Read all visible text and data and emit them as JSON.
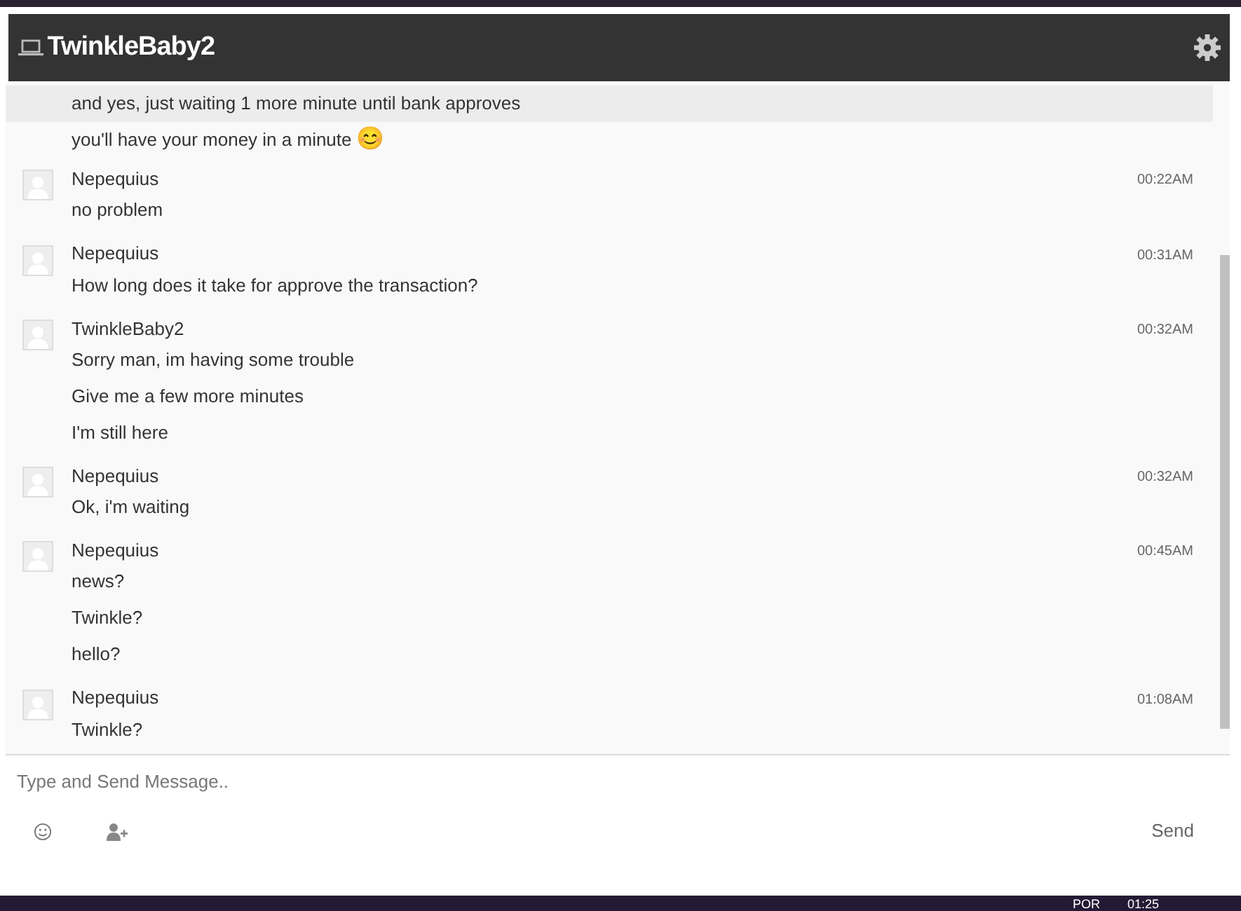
{
  "window": {
    "title": "TwinkleBaby2"
  },
  "messages": [
    {
      "lines": [
        {
          "text": "and yes, just waiting 1 more minute until bank approves",
          "highlighted": true
        },
        {
          "text": "you'll have your money in a minute",
          "highlighted": false,
          "emoji": "😊"
        }
      ]
    },
    {
      "sender": "Nepequius",
      "time": "00:22AM",
      "lines": [
        {
          "text": "no problem",
          "highlighted": false
        }
      ]
    },
    {
      "sender": "Nepequius",
      "time": "00:31AM",
      "lines": [
        {
          "text": "How long does it take for approve the transaction?",
          "highlighted": false
        }
      ]
    },
    {
      "sender": "TwinkleBaby2",
      "time": "00:32AM",
      "lines": [
        {
          "text": "Sorry man, im having some trouble",
          "highlighted": false
        },
        {
          "text": "Give me a few more minutes",
          "highlighted": false
        },
        {
          "text": "I'm still here",
          "highlighted": false
        }
      ]
    },
    {
      "sender": "Nepequius",
      "time": "00:32AM",
      "lines": [
        {
          "text": "Ok, i'm waiting",
          "highlighted": false
        }
      ]
    },
    {
      "sender": "Nepequius",
      "time": "00:45AM",
      "lines": [
        {
          "text": "news?",
          "highlighted": false
        },
        {
          "text": "Twinkle?",
          "highlighted": false
        },
        {
          "text": "hello?",
          "highlighted": false
        }
      ]
    },
    {
      "sender": "Nepequius",
      "time": "01:08AM",
      "lines": [
        {
          "text": "Twinkle?",
          "highlighted": false
        }
      ]
    }
  ],
  "composer": {
    "placeholder": "Type and Send Message..",
    "send": "Send"
  },
  "taskbar": {
    "language": "POR",
    "clock": "01:25"
  }
}
